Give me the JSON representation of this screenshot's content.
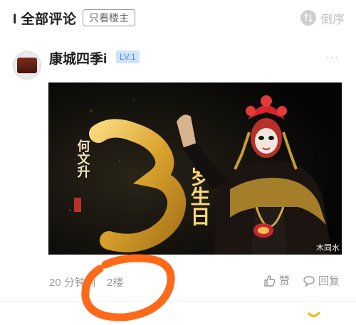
{
  "header": {
    "title": "I 全部评论",
    "filter_label": "只看楼主",
    "sort_label": "倒序",
    "sort_icon": "sort-icon"
  },
  "comment": {
    "avatar_icon": "avatar",
    "username": "康城四季i",
    "level": "LV.1",
    "more_icon": "more-icon",
    "image": {
      "name_text": "何文升",
      "big_number": "3",
      "birthday_text": "岁生日",
      "watermark": "木同水"
    },
    "time": "20 分钟前",
    "floor": "2楼",
    "like_label": "赞",
    "reply_label": "回复"
  },
  "colors": {
    "level_bg": "#cfe4fb",
    "level_text": "#4a8fdc",
    "annotation": "#ff6a1a",
    "gold": "#e5b33a"
  }
}
